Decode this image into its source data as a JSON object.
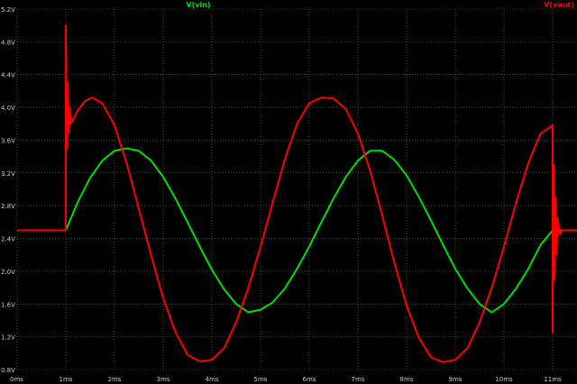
{
  "colors": {
    "background": "#000000",
    "grid": "#6f6f6f",
    "tick_text": "#c8c8c8",
    "vin": "#00e000",
    "vout": "#ff0000"
  },
  "chart_data": {
    "type": "line",
    "title": "",
    "xlabel": "",
    "ylabel": "",
    "xlim": [
      0,
      11.5
    ],
    "ylim": [
      0.8,
      5.2
    ],
    "grid": true,
    "legend": "top",
    "x_ticks": [
      "0ms",
      "1ms",
      "2ms",
      "3ms",
      "4ms",
      "5ms",
      "6ms",
      "7ms",
      "8ms",
      "9ms",
      "10ms",
      "11ms"
    ],
    "x_tick_values": [
      0,
      1,
      2,
      3,
      4,
      5,
      6,
      7,
      8,
      9,
      10,
      11
    ],
    "y_ticks": [
      "0.8V",
      "1.2V",
      "1.6V",
      "2.0V",
      "2.4V",
      "2.8V",
      "3.2V",
      "3.6V",
      "4.0V",
      "4.4V",
      "4.8V",
      "5.2V"
    ],
    "y_tick_values": [
      0.8,
      1.2,
      1.6,
      2.0,
      2.4,
      2.8,
      3.2,
      3.6,
      4.0,
      4.4,
      4.8,
      5.2
    ],
    "series": [
      {
        "name": "V(vin)",
        "color": "#00e000",
        "x": [
          0,
          0.5,
          1.0,
          1.25,
          1.5,
          1.75,
          2.0,
          2.25,
          2.5,
          2.75,
          3.0,
          3.25,
          3.5,
          3.75,
          4.0,
          4.25,
          4.5,
          4.75,
          5.0,
          5.25,
          5.5,
          5.75,
          6.0,
          6.25,
          6.5,
          6.75,
          7.0,
          7.25,
          7.5,
          7.75,
          8.0,
          8.25,
          8.5,
          8.75,
          9.0,
          9.25,
          9.5,
          9.75,
          10.0,
          10.25,
          10.5,
          10.75,
          11.0,
          11.5
        ],
        "y": [
          2.5,
          2.5,
          2.5,
          2.85,
          3.14,
          3.35,
          3.47,
          3.5,
          3.47,
          3.35,
          3.15,
          2.89,
          2.6,
          2.3,
          2.02,
          1.78,
          1.6,
          1.5,
          1.53,
          1.62,
          1.79,
          2.03,
          2.3,
          2.6,
          2.89,
          3.15,
          3.35,
          3.47,
          3.47,
          3.36,
          3.17,
          2.91,
          2.62,
          2.32,
          2.03,
          1.79,
          1.6,
          1.5,
          1.6,
          1.79,
          2.03,
          2.32,
          2.5,
          2.5
        ]
      },
      {
        "name": "V(vout)",
        "color": "#ff0000",
        "x": [
          0,
          0.5,
          1.0,
          1.0,
          1.02,
          1.04,
          1.06,
          1.08,
          1.1,
          1.15,
          1.25,
          1.4,
          1.55,
          1.75,
          2.0,
          2.25,
          2.5,
          2.75,
          3.0,
          3.25,
          3.5,
          3.75,
          4.0,
          4.25,
          4.5,
          4.75,
          5.0,
          5.25,
          5.5,
          5.75,
          6.0,
          6.25,
          6.5,
          6.75,
          7.0,
          7.25,
          7.5,
          7.75,
          8.0,
          8.25,
          8.5,
          8.75,
          9.0,
          9.25,
          9.5,
          9.75,
          10.0,
          10.25,
          10.5,
          10.75,
          11.0,
          11.0,
          11.02,
          11.04,
          11.06,
          11.08,
          11.1,
          11.15,
          11.2,
          11.5
        ],
        "y": [
          2.5,
          2.5,
          2.5,
          5.0,
          3.5,
          4.3,
          3.7,
          4.0,
          3.8,
          3.85,
          3.97,
          4.08,
          4.12,
          4.05,
          3.78,
          3.32,
          2.76,
          2.2,
          1.67,
          1.26,
          0.98,
          0.9,
          0.92,
          1.06,
          1.38,
          1.8,
          2.3,
          2.84,
          3.37,
          3.8,
          4.05,
          4.12,
          4.11,
          3.98,
          3.68,
          3.23,
          2.68,
          2.1,
          1.58,
          1.19,
          0.95,
          0.89,
          0.92,
          1.06,
          1.38,
          1.8,
          2.3,
          2.84,
          3.32,
          3.68,
          3.78,
          1.25,
          3.3,
          1.9,
          2.9,
          2.2,
          2.65,
          2.45,
          2.5,
          2.5
        ]
      }
    ]
  }
}
